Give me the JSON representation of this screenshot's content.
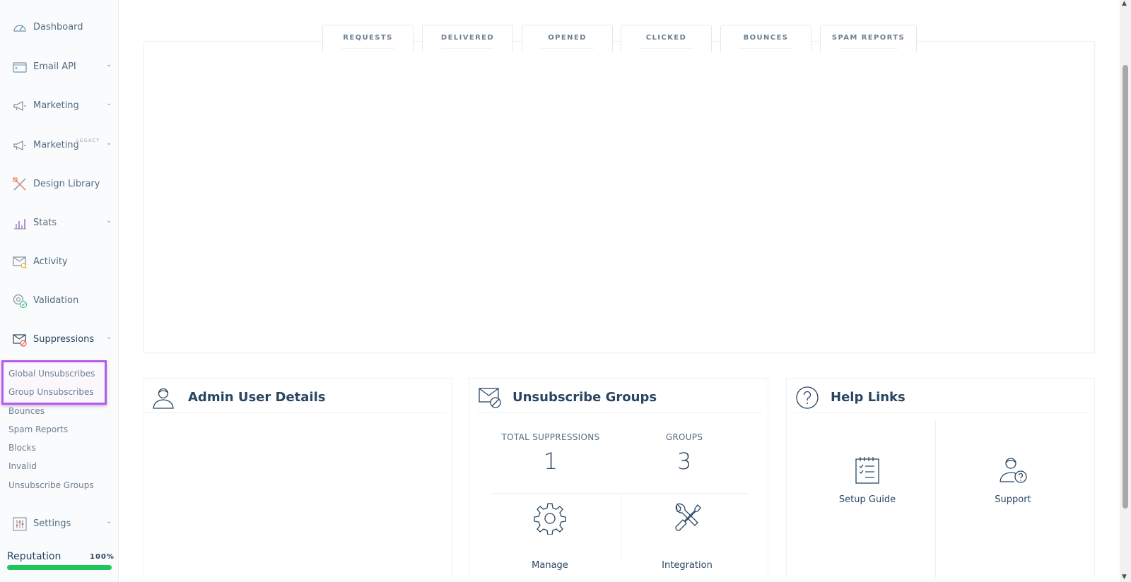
{
  "sidebar": {
    "items": [
      {
        "label": "Dashboard",
        "icon": "gauge-icon",
        "chevron": false
      },
      {
        "label": "Email API",
        "icon": "terminal-icon",
        "chevron": true
      },
      {
        "label": "Marketing",
        "icon": "megaphone-icon",
        "chevron": true
      },
      {
        "label": "Marketing",
        "icon": "megaphone-icon",
        "chevron": true,
        "badge": "LEGACY"
      },
      {
        "label": "Design Library",
        "icon": "design-tools-icon",
        "chevron": false
      },
      {
        "label": "Stats",
        "icon": "bar-chart-icon",
        "chevron": true
      },
      {
        "label": "Activity",
        "icon": "mail-search-icon",
        "chevron": false
      },
      {
        "label": "Validation",
        "icon": "at-check-icon",
        "chevron": false
      },
      {
        "label": "Suppressions",
        "icon": "mail-blocked-icon",
        "chevron": true
      },
      {
        "label": "Settings",
        "icon": "sliders-icon",
        "chevron": true
      }
    ],
    "chevron_glyph": "⌄",
    "suppressions_sub": [
      "Global Unsubscribes",
      "Group Unsubscribes",
      "Bounces",
      "Spam Reports",
      "Blocks",
      "Invalid",
      "Unsubscribe Groups"
    ],
    "reputation": {
      "label": "Reputation",
      "value_text": "100%",
      "value": 100,
      "color": "#1ec45c"
    },
    "highlight_color": "#b45bea"
  },
  "tabs": [
    "REQUESTS",
    "DELIVERED",
    "OPENED",
    "CLICKED",
    "BOUNCES",
    "SPAM REPORTS"
  ],
  "cards": {
    "admin": {
      "title": "Admin User Details",
      "icon": "user-icon"
    },
    "groups": {
      "title": "Unsubscribe Groups",
      "icon": "mail-blocked-icon",
      "total_label": "TOTAL SUPPRESSIONS",
      "total_value": "1",
      "groups_label": "GROUPS",
      "groups_value": "3",
      "manage_label": "Manage",
      "integration_label": "Integration"
    },
    "help": {
      "title": "Help Links",
      "icon": "question-icon",
      "setup_label": "Setup Guide",
      "support_label": "Support"
    }
  },
  "colors": {
    "text": "#294661",
    "muted": "#546b81"
  }
}
